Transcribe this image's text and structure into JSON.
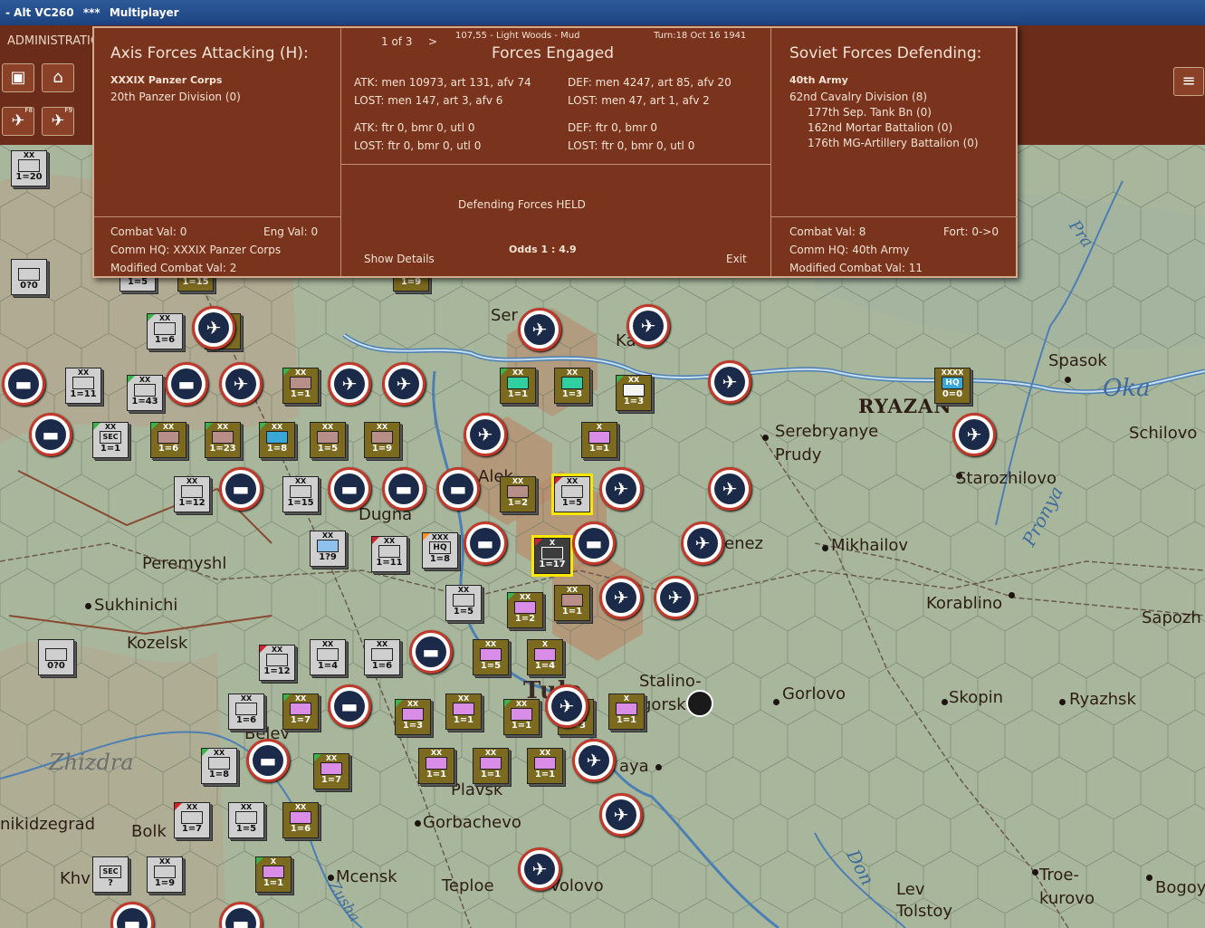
{
  "window": {
    "title": "- Alt VC260",
    "marks": "***",
    "mode": "Multiplayer"
  },
  "toolbar": {
    "admin_label": "ADMINISTRATIO",
    "hotkeys": [
      "F8",
      "F9"
    ]
  },
  "dialog": {
    "axis": {
      "heading": "Axis Forces Attacking (H):",
      "corps": "XXXIX Panzer Corps",
      "units": [
        "20th Panzer Division (0)"
      ],
      "combat_val": "Combat Val: 0",
      "eng_val": "Eng Val: 0",
      "comm_hq": "Comm HQ: XXXIX Panzer Corps",
      "modified": "Modified Combat Val: 2"
    },
    "middle": {
      "pager": "1 of 3",
      "next": ">",
      "terrain": "107,55 - Light Woods - Mud",
      "turn": "Turn:18  Oct 16 1941",
      "heading": "Forces Engaged",
      "atk_ground": "ATK: men 10973, art 131, afv 74",
      "atk_ground_lost": "LOST: men 147, art 3, afv 6",
      "def_ground": "DEF: men 4247, art 85, afv 20",
      "def_ground_lost": "LOST: men 47, art 1, afv 2",
      "atk_air": "ATK: ftr 0, bmr 0, utl 0",
      "atk_air_lost": "LOST: ftr 0, bmr 0, utl 0",
      "def_air": "DEF: ftr 0, bmr 0",
      "def_air_lost": "LOST: ftr 0, bmr 0, utl 0",
      "result": "Defending Forces HELD",
      "show_details": "Show Details",
      "odds": "Odds 1 : 4.9",
      "exit": "Exit"
    },
    "soviet": {
      "heading": "Soviet Forces Defending:",
      "army": "40th Army",
      "units": [
        "62nd Cavalry Division (8)",
        "177th Sep. Tank Bn (0)",
        "162nd Mortar Battalion (0)",
        "176th MG-Artillery Battalion (0)"
      ],
      "combat_val": "Combat Val: 8",
      "fort": "Fort: 0->0",
      "comm_hq": "Comm HQ: 40th Army",
      "modified": "Modified Combat Val: 11"
    }
  },
  "map": {
    "cities": [
      "Spasok",
      "RYAZAN",
      "Serebryanye",
      "Prudy",
      "Schilovo",
      "Starozhilovo",
      "Mikhailov",
      "Korablino",
      "Sapozh",
      "Peremyshl",
      "Sukhinichi",
      "Kozelsk",
      "Dugna",
      "Stalino-",
      "gorsk",
      "Gorlovo",
      "Skopin",
      "Ryazhsk",
      "Plavsk",
      "Gorbachevo",
      "Mcensk",
      "Teploe",
      "Volovo",
      "Lev",
      "Tolstoy",
      "Troe-",
      "kurovo",
      "Bogoy",
      "Bolk",
      "Khv",
      "Belev",
      "nikidzegrad",
      "Ser",
      "Ka",
      "Alek",
      "enez",
      "aya",
      "Tula"
    ],
    "rivers": [
      "Oka",
      "Pra",
      "Pronya",
      "Zhizdra",
      "Don",
      "Zusha"
    ],
    "counters": [
      {
        "size": "XX",
        "value": "1=20"
      },
      {
        "size": "XX",
        "value": "1=5"
      },
      {
        "size": "XX",
        "value": "1=15"
      },
      {
        "size": "XX",
        "value": "1=9"
      },
      {
        "size": "XX",
        "value": "1=6"
      },
      {
        "size": "XX",
        "value": "1=5"
      },
      {
        "size": "XX",
        "value": "1=11"
      },
      {
        "size": "XX",
        "value": "1=43"
      },
      {
        "size": "XX",
        "value": "1=1"
      },
      {
        "size": "XX",
        "value": "1=1"
      },
      {
        "size": "XX",
        "value": "1=3"
      },
      {
        "size": "XX",
        "value": "1=3"
      },
      {
        "size": "XX",
        "value": "1=6"
      },
      {
        "size": "XX",
        "value": "1=23"
      },
      {
        "size": "XX",
        "value": "1=8"
      },
      {
        "size": "XX",
        "value": "1=5"
      },
      {
        "size": "XX",
        "value": "1=9"
      },
      {
        "size": "X",
        "value": "1=1"
      },
      {
        "size": "XX",
        "value": "1=12"
      },
      {
        "size": "XX",
        "value": "1=15"
      },
      {
        "size": "XX",
        "value": "1=2"
      },
      {
        "size": "XX",
        "value": "1=5"
      },
      {
        "size": "XX",
        "value": "1?9"
      },
      {
        "size": "XX",
        "value": "1=11"
      },
      {
        "size": "XXX",
        "value": "1=8",
        "label": "HQ"
      },
      {
        "size": "X",
        "value": "1=17"
      },
      {
        "size": "XX",
        "value": "1=5"
      },
      {
        "size": "XX",
        "value": "1=2"
      },
      {
        "size": "XX",
        "value": "1=1"
      },
      {
        "size": "XX",
        "value": "1=12"
      },
      {
        "size": "XX",
        "value": "1=4"
      },
      {
        "size": "XX",
        "value": "1=6"
      },
      {
        "size": "XX",
        "value": "1=5"
      },
      {
        "size": "X",
        "value": "1=4"
      },
      {
        "size": "XX",
        "value": "1=6"
      },
      {
        "size": "XX",
        "value": "1=7"
      },
      {
        "size": "XX",
        "value": "1=3"
      },
      {
        "size": "XX",
        "value": "1=1"
      },
      {
        "size": "XX",
        "value": "1=1"
      },
      {
        "size": "XX",
        "value": "1=3"
      },
      {
        "size": "X",
        "value": "1=1"
      },
      {
        "size": "XX",
        "value": "1=8"
      },
      {
        "size": "XX",
        "value": "1=7"
      },
      {
        "size": "XX",
        "value": "1=1"
      },
      {
        "size": "XX",
        "value": "1=1"
      },
      {
        "size": "XX",
        "value": "1=1"
      },
      {
        "size": "XX",
        "value": "1=7"
      },
      {
        "size": "XX",
        "value": "1=5"
      },
      {
        "size": "XX",
        "value": "1=6"
      },
      {
        "size": "XX",
        "value": "1=9"
      },
      {
        "size": "X",
        "value": "1=1"
      },
      {
        "size": "XXXX",
        "value": "0=0",
        "label": "HQ"
      },
      {
        "size": "XX",
        "value": "1=1",
        "label": "SEC"
      },
      {
        "size": "",
        "value": "0?0"
      },
      {
        "size": "",
        "value": "0?0"
      },
      {
        "size": "",
        "value": "?",
        "label": "SEC"
      }
    ]
  }
}
